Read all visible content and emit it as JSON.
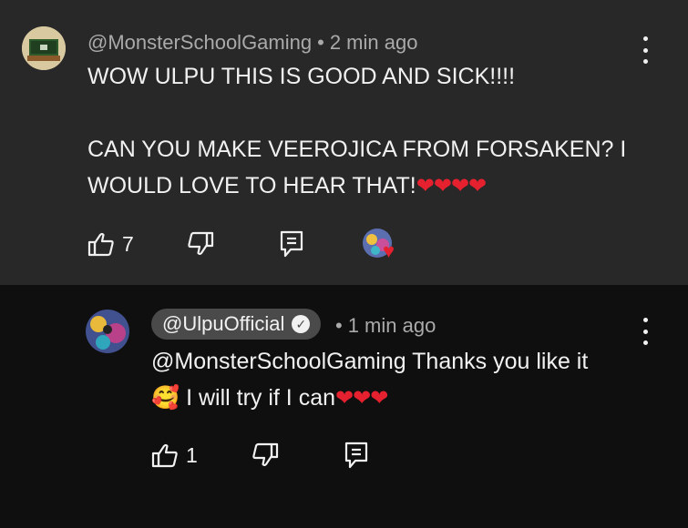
{
  "comment": {
    "author": "@MonsterSchoolGaming",
    "separator": "•",
    "time": "2 min ago",
    "line1": "WOW ULPU THIS IS GOOD AND SICK!!!!",
    "line2": "CAN YOU MAKE VEEROJICA FROM FORSAKEN? I",
    "line3": "WOULD LOVE TO HEAR THAT!",
    "hearts": "❤❤❤❤",
    "like_count": "7",
    "creator_heart": "♥"
  },
  "reply": {
    "author": "@UlpuOfficial",
    "verified_mark": "✓",
    "separator": "•",
    "time": "1 min ago",
    "line1": "@MonsterSchoolGaming Thanks you like it",
    "emoji": "🥰",
    "line2": " I will try if I can",
    "hearts": "❤❤❤",
    "like_count": "1"
  },
  "colors": {
    "comment_bg": "#282828",
    "reply_bg": "#0f0f0f",
    "heart": "#e5202f",
    "meta_text": "#aaaaaa"
  }
}
